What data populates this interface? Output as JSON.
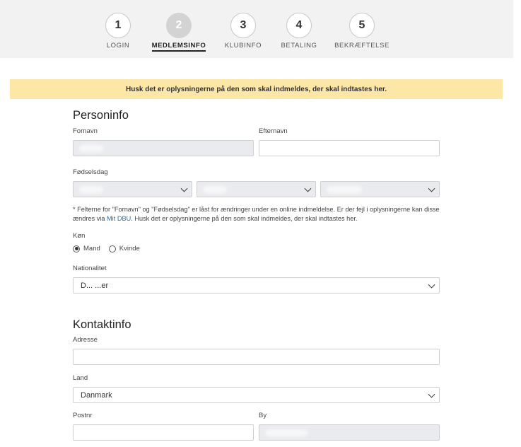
{
  "stepper": {
    "steps": [
      {
        "number": "1",
        "label": "LOGIN",
        "active": false
      },
      {
        "number": "2",
        "label": "MEDLEMSINFO",
        "active": true
      },
      {
        "number": "3",
        "label": "KLUBINFO",
        "active": false
      },
      {
        "number": "4",
        "label": "BETALING",
        "active": false
      },
      {
        "number": "5",
        "label": "BEKRÆFTELSE",
        "active": false
      }
    ]
  },
  "notice": "Husk det er oplysningerne på den som skal indmeldes, der skal indtastes her.",
  "personinfo": {
    "title": "Personinfo",
    "first_name_label": "Fornavn",
    "last_name_label": "Efternavn",
    "birthday_label": "Fødselsdag",
    "help_text_before_link": "* Felterne for \"Fornavn\" og \"Fødselsdag\" er låst for ændringer under en online indmeldelse. Er der fejl i oplysningerne kan disse ændres via ",
    "help_link": "Mit DBU",
    "help_text_after_link": ". Husk det er oplysningerne på den som skal indmeldes, der skal indtastes her.",
    "gender_label": "Køn",
    "gender_options": [
      "Mand",
      "Kvinde"
    ],
    "gender_selected": "Mand",
    "nationality_label": "Nationalitet",
    "nationality_value": "D... ...er"
  },
  "kontaktinfo": {
    "title": "Kontaktinfo",
    "address_label": "Adresse",
    "country_label": "Land",
    "country_value": "Danmark",
    "postal_label": "Postnr",
    "city_label": "By"
  },
  "colors": {
    "notice_bg": "#fde7a6",
    "locked_field_bg": "#e9ebee",
    "link": "#2b6cb0"
  }
}
